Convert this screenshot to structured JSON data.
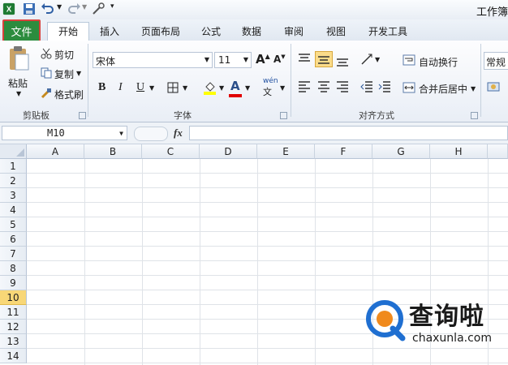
{
  "window": {
    "title": "工作簿"
  },
  "tabs": {
    "file": "文件",
    "items": [
      "开始",
      "插入",
      "页面布局",
      "公式",
      "数据",
      "审阅",
      "视图",
      "开发工具"
    ]
  },
  "clipboard": {
    "paste": "粘贴",
    "cut": "剪切",
    "copy": "复制",
    "format_painter": "格式刷",
    "label": "剪贴板"
  },
  "font": {
    "name": "宋体",
    "size": "11",
    "bold": "B",
    "italic": "I",
    "underline": "U",
    "label": "字体",
    "grow": "A",
    "shrink": "A",
    "color_letter": "A",
    "wen": "wén"
  },
  "alignment": {
    "wrap_text": "自动换行",
    "merge_center": "合并后居中",
    "label": "对齐方式"
  },
  "number": {
    "format": "常规"
  },
  "formula_bar": {
    "name_box": "M10",
    "fx": "fx",
    "value": ""
  },
  "sheet": {
    "columns": [
      "A",
      "B",
      "C",
      "D",
      "E",
      "F",
      "G",
      "H"
    ],
    "rows": [
      "1",
      "2",
      "3",
      "4",
      "5",
      "6",
      "7",
      "8",
      "9",
      "10",
      "11",
      "12",
      "13",
      "14"
    ],
    "active_row": "10"
  },
  "watermark": {
    "text": "查询啦",
    "url": "chaxunla.com"
  },
  "colors": {
    "file_tab": "#2c8c3e",
    "highlight_border": "#d9413c",
    "active_row": "#f8d777",
    "watermark_blue": "#1f6fd1",
    "watermark_orange": "#f08a1d"
  }
}
